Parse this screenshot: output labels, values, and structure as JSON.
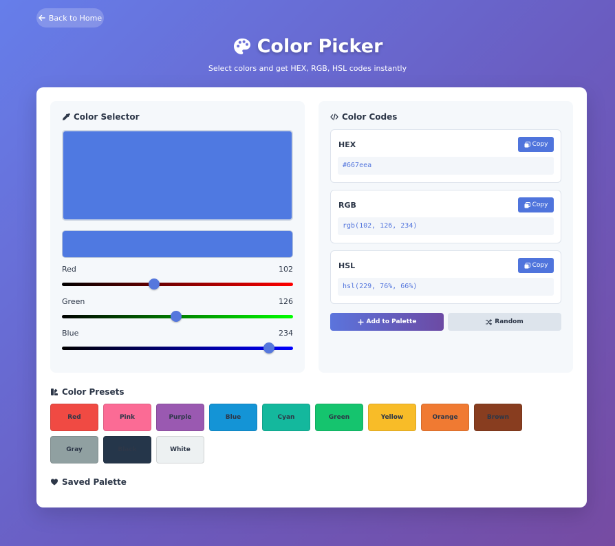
{
  "nav": {
    "back_label": "Back to Home"
  },
  "header": {
    "title": "Color Picker",
    "subtitle": "Select colors and get HEX, RGB, HSL codes instantly"
  },
  "selector": {
    "title": "Color Selector",
    "current_color": "#4f79e1",
    "sliders": [
      {
        "label": "Red",
        "value": "102",
        "fraction": 0.4
      },
      {
        "label": "Green",
        "value": "126",
        "fraction": 0.494
      },
      {
        "label": "Blue",
        "value": "234",
        "fraction": 0.896
      }
    ]
  },
  "codes": {
    "title": "Color Codes",
    "copy_label": "Copy",
    "items": [
      {
        "label": "HEX",
        "value": "#667eea"
      },
      {
        "label": "RGB",
        "value": "rgb(102, 126, 234)"
      },
      {
        "label": "HSL",
        "value": "hsl(229, 76%, 66%)"
      }
    ],
    "add_label": "Add to Palette",
    "random_label": "Random"
  },
  "presets": {
    "title": "Color Presets",
    "items": [
      {
        "name": "Red",
        "color": "#f04a43"
      },
      {
        "name": "Pink",
        "color": "#fb6b95"
      },
      {
        "name": "Purple",
        "color": "#9a59b1"
      },
      {
        "name": "Blue",
        "color": "#1494d6"
      },
      {
        "name": "Cyan",
        "color": "#14b89d"
      },
      {
        "name": "Green",
        "color": "#15c46e"
      },
      {
        "name": "Yellow",
        "color": "#f8bc28"
      },
      {
        "name": "Orange",
        "color": "#f07a32"
      },
      {
        "name": "Brown",
        "color": "#883d1f"
      },
      {
        "name": "Gray",
        "color": "#90a0a1"
      },
      {
        "name": "Black",
        "color": "#25364a"
      },
      {
        "name": "White",
        "color": "#edf1f2"
      }
    ]
  },
  "palette": {
    "title": "Saved Palette"
  }
}
